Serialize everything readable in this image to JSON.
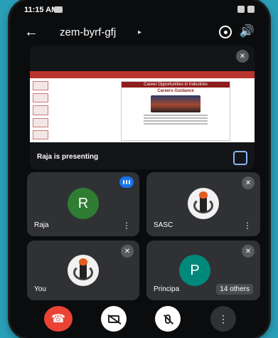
{
  "status_bar": {
    "time": "11:15 AM"
  },
  "header": {
    "meeting_code": "zem-byrf-gfj",
    "back_icon": "arrow-left-icon",
    "caret": "▸"
  },
  "presentation": {
    "presenter_label": "Raja is presenting",
    "slide_title": "Career Opportunities in Industries",
    "slide_subtitle": "Careers Guidance"
  },
  "participants": [
    {
      "name": "Raja",
      "initial": "R",
      "avatar_color": "#2e7d32",
      "speaking": true
    },
    {
      "name": "SASC",
      "logo": true,
      "muted": true
    },
    {
      "name": "You",
      "logo": true,
      "muted": true
    },
    {
      "name": "Principa",
      "initial": "P",
      "avatar_color": "#00897b",
      "muted": true,
      "others_label": "14 others"
    }
  ],
  "controls": {
    "more_label": "⋮"
  },
  "colors": {
    "hangup": "#ea4335",
    "tile": "#303134",
    "speaking": "#1a73e8"
  }
}
